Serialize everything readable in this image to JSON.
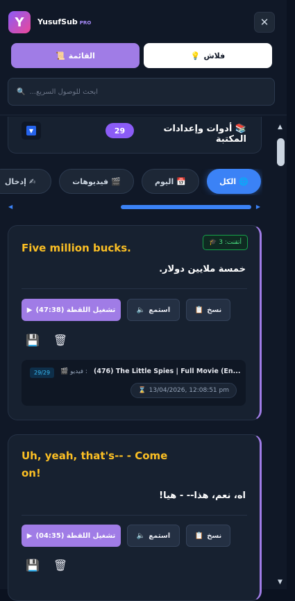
{
  "header": {
    "app_name": "YusufSub",
    "pro_label": "PRO",
    "logo_glyph": "Y",
    "close_glyph": "✕"
  },
  "tabs": [
    {
      "label": "القائمة",
      "icon": "📜"
    },
    {
      "label": "فلاش",
      "icon": "💡"
    }
  ],
  "search": {
    "placeholder": "ابحث للوصول السريع...",
    "icon": "🔍"
  },
  "tools": {
    "title": "أدوات وإعدادات المكتبة",
    "icon": "📚",
    "count": "29",
    "dropdown_glyph": "▼"
  },
  "filters": [
    {
      "label": "الكل",
      "icon": "🌐",
      "active": true
    },
    {
      "label": "اليوم",
      "icon": "📅",
      "active": false
    },
    {
      "label": "فيديوهات",
      "icon": "🎬",
      "active": false
    },
    {
      "label": "إدخال",
      "icon": "✍",
      "active": false
    }
  ],
  "cards": [
    {
      "english": "Five million bucks.",
      "arabic": "خمسة ملايين دولار.",
      "learned_badge": "أتقنت: 3",
      "play_label": "تشغيل اللقطة (47:38)",
      "listen_label": "استمع",
      "copy_label": "نسخ",
      "source_badge": "29/29",
      "source_type": "فيديو :",
      "source_title": "(476) The Little Spies | Full Movie (En...",
      "date": "13/04/2026, 12:08:51 pm"
    },
    {
      "english": "Uh, yeah, that's-- - Come on!",
      "arabic": "اه، نعم، هذا-- - هيا!",
      "play_label": "تشغيل اللقطة (04:35)",
      "listen_label": "استمع",
      "copy_label": "نسخ"
    }
  ],
  "colors": {
    "accent": "#a07ce6",
    "active_filter": "#3b82f6",
    "english_text": "#fbbf24"
  }
}
